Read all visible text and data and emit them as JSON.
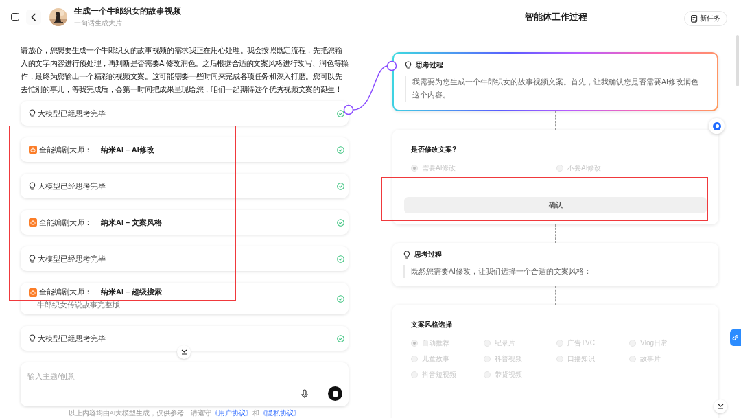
{
  "header": {
    "title": "生成一个牛郎织女的故事视频",
    "subtitle": "一句话生成大片"
  },
  "message": "请放心，您想要生成一个牛郎织女的故事视频的需求我正在用心处理。我会按照既定流程，先把您输入的文字内容进行预处理，再判断是否需要AI修改润色。之后根据合适的文案风格进行改写、润色等操作，最终为您输出一个精彩的视频文案。这可能需要一些时间来完成各项任务和深入打磨。您可以先去忙别的事儿，等我完成后，会第一时间把成果呈现给您，咱们一起期待这个优秀视频文案的诞生！",
  "steps": [
    {
      "kind": "thought",
      "label": "大模型已经思考完毕",
      "done": true
    },
    {
      "kind": "agent",
      "label": "全能编剧大师：",
      "target": "纳米AI – AI修改",
      "done": true
    },
    {
      "kind": "thought",
      "label": "大模型已经思考完毕",
      "done": true
    },
    {
      "kind": "agent",
      "label": "全能编剧大师：",
      "target": "纳米AI – 文案风格",
      "done": true
    },
    {
      "kind": "thought",
      "label": "大模型已经思考完毕",
      "done": true
    },
    {
      "kind": "agent",
      "label": "全能编剧大师：",
      "target": "纳米AI – 超级搜索",
      "detail": "牛郎织女传说故事完整版",
      "done": true
    },
    {
      "kind": "thought",
      "label": "大模型已经思考完毕",
      "done": true
    }
  ],
  "input": {
    "placeholder": "输入主题/创意"
  },
  "footer": {
    "note": "以上内容均由AI大模型生成，仅供参考",
    "agree": "请遵守",
    "links": [
      "《用户协议》",
      "《隐私协议》"
    ],
    "joiner": "和"
  },
  "panel": {
    "title": "智能体工作过程",
    "new_task": "新任务"
  },
  "flow": [
    {
      "kind": "thinking",
      "title": "思考过程",
      "text": "我需要为您生成一个牛郎织女的故事视频文案。首先，让我确认您是否需要AI修改润色这个内容。",
      "active": true
    },
    {
      "kind": "binary_choice",
      "question": "是否修改文案?",
      "disabled": true,
      "button": "确认",
      "options": [
        {
          "label": "需要AI修改",
          "selected": true
        },
        {
          "label": "不要AI修改",
          "selected": false
        }
      ]
    },
    {
      "kind": "thinking",
      "title": "思考过程",
      "text": "既然您需要AI修改，让我们选择一个合适的文案风格：",
      "active": false
    },
    {
      "kind": "grid_choice",
      "question": "文案风格选择",
      "disabled": true,
      "options": [
        {
          "label": "自动推荐",
          "selected": true
        },
        {
          "label": "纪录片",
          "selected": false
        },
        {
          "label": "广告TVC",
          "selected": false
        },
        {
          "label": "Vlog日常",
          "selected": false
        },
        {
          "label": "儿童故事",
          "selected": false
        },
        {
          "label": "科普视频",
          "selected": false
        },
        {
          "label": "口播知识",
          "selected": false
        },
        {
          "label": "故事片",
          "selected": false
        },
        {
          "label": "抖音短视频",
          "selected": false
        },
        {
          "label": "带货视频",
          "selected": false
        }
      ]
    }
  ]
}
